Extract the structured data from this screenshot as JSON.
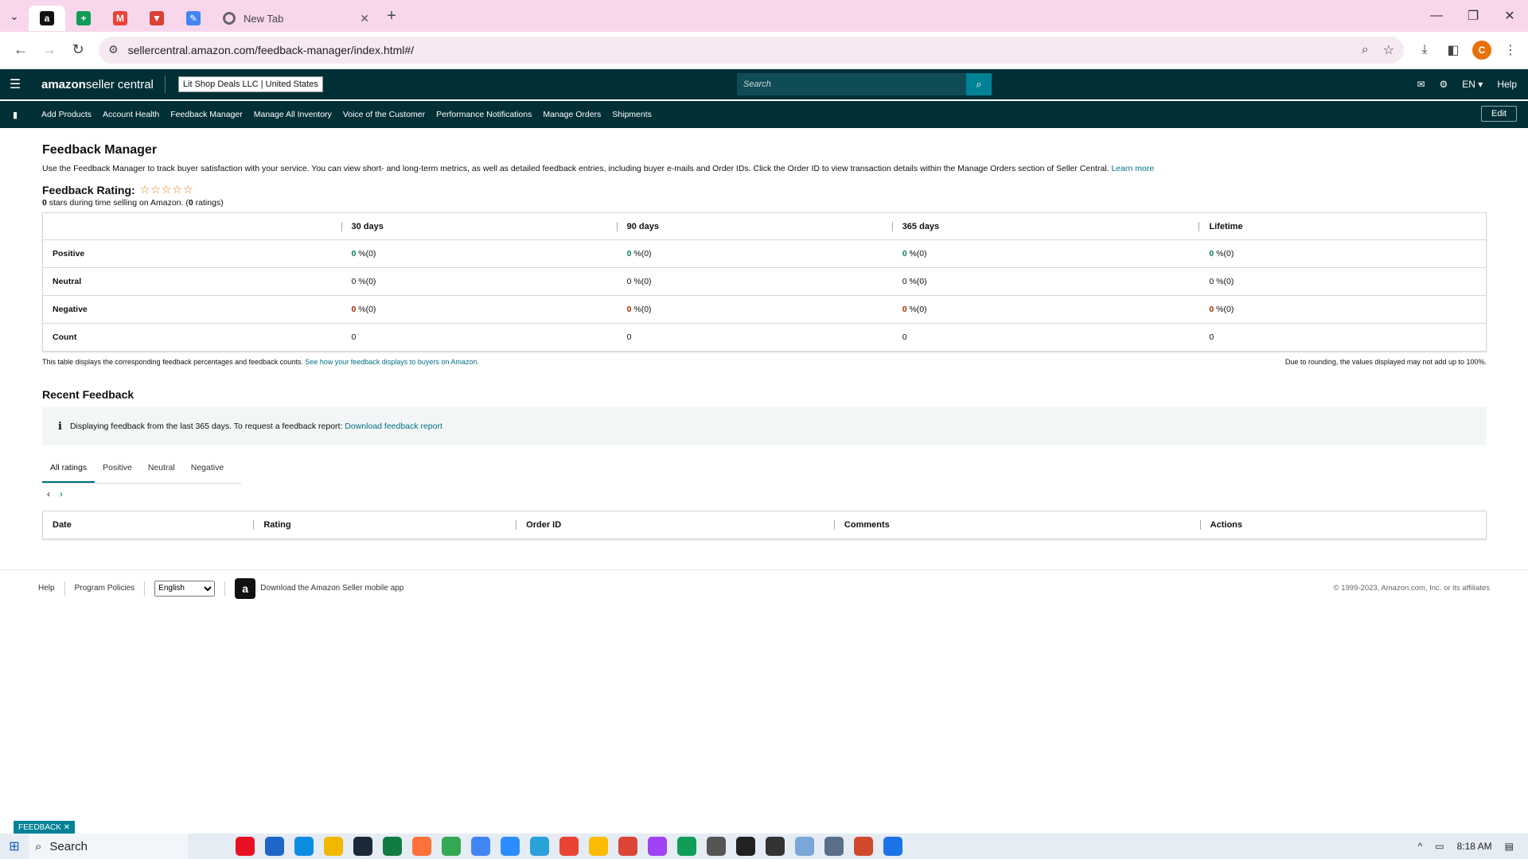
{
  "browser": {
    "tabs": [
      {
        "icon": "amazon-icon",
        "glyph": "a",
        "color": "#111111",
        "active": true
      },
      {
        "icon": "sheets-icon",
        "glyph": "+",
        "color": "#0f9d58"
      },
      {
        "icon": "gmail-icon",
        "glyph": "M",
        "color": "#ea4335"
      },
      {
        "icon": "todoist-icon",
        "glyph": "▼",
        "color": "#db4035"
      },
      {
        "icon": "tool-icon",
        "glyph": "✎",
        "color": "#4285f4"
      }
    ],
    "new_tab_label": "New Tab",
    "url": "sellercentral.amazon.com/feedback-manager/index.html#/",
    "profile_initial": "C"
  },
  "header": {
    "logo_bold": "amazon",
    "logo_rest": " seller central",
    "store": "Lit Shop Deals LLC | United States",
    "search_placeholder": "Search",
    "lang": "EN ▾",
    "help": "Help"
  },
  "nav": {
    "items": [
      "Add Products",
      "Account Health",
      "Feedback Manager",
      "Manage All Inventory",
      "Voice of the Customer",
      "Performance Notifications",
      "Manage Orders",
      "Shipments"
    ],
    "edit": "Edit"
  },
  "main": {
    "title": "Feedback Manager",
    "description": "Use the Feedback Manager to track buyer satisfaction with your service. You can view short- and long-term metrics, as well as detailed feedback entries, including buyer e-mails and Order IDs. Click the Order ID to view transaction details within the Manage Orders section of Seller Central.",
    "learn_more": "Learn more",
    "rating_label": "Feedback Rating:",
    "stars": "☆☆☆☆☆",
    "rating_stars": "0",
    "rating_text_mid": " stars during time selling on Amazon. (",
    "rating_count": "0",
    "rating_text_end": " ratings)",
    "table": {
      "columns": [
        "30 days",
        "90 days",
        "365 days",
        "Lifetime"
      ],
      "rows": [
        {
          "label": "Positive",
          "values": [
            "0",
            "0",
            "0",
            "0"
          ],
          "suffix": " %(0)",
          "tone": "g"
        },
        {
          "label": "Neutral",
          "values": [
            "0",
            "0",
            "0",
            "0"
          ],
          "suffix": " %(0)",
          "tone": ""
        },
        {
          "label": "Negative",
          "values": [
            "0",
            "0",
            "0",
            "0"
          ],
          "suffix": " %(0)",
          "tone": "r"
        },
        {
          "label": "Count",
          "values": [
            "0",
            "0",
            "0",
            "0"
          ],
          "suffix": "",
          "tone": ""
        }
      ]
    },
    "table_note": "This table displays the corresponding feedback percentages and feedback counts.",
    "table_note_link": "See how your feedback displays to buyers on Amazon.",
    "rounding_note": "Due to rounding, the values displayed may not add up to 100%.",
    "recent_title": "Recent Feedback",
    "info_text": "Displaying feedback from the last 365 days. To request a feedback report:",
    "info_link": "Download feedback report",
    "tabs": [
      "All ratings",
      "Positive",
      "Neutral",
      "Negative"
    ],
    "recent_columns": [
      "Date",
      "Rating",
      "Order ID",
      "Comments",
      "Actions"
    ]
  },
  "footer": {
    "help": "Help",
    "policies": "Program Policies",
    "language": "English",
    "app_text": "Download the Amazon Seller mobile app",
    "copyright": "© 1999-2023, Amazon.com, Inc. or its affiliates"
  },
  "feedback_tag": "FEEDBACK ✕",
  "taskbar": {
    "search": "Search",
    "time": "8:18 AM"
  }
}
